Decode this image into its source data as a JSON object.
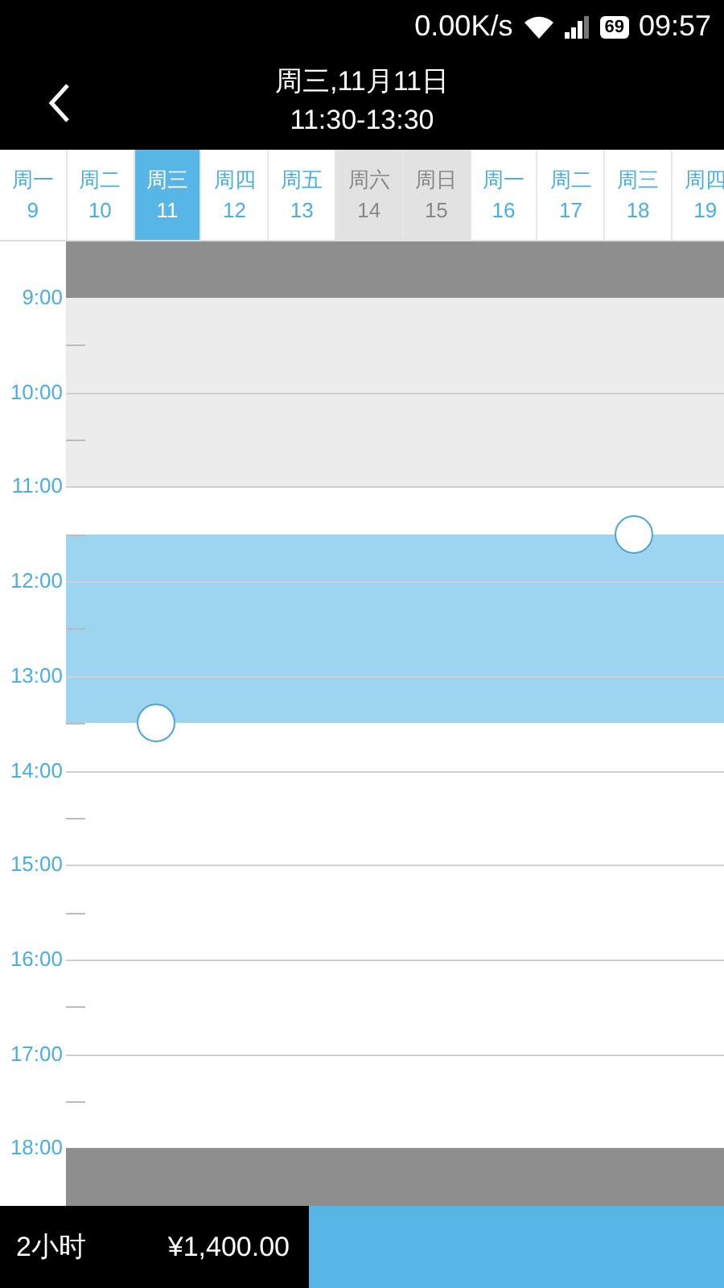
{
  "status_bar": {
    "network_speed": "0.00K/s",
    "battery": "69",
    "time": "09:57"
  },
  "header": {
    "title": "周三,11月11日",
    "subtitle": "11:30-13:30"
  },
  "days": [
    {
      "weekday": "周一",
      "day": "9",
      "selected": false,
      "weekend": false
    },
    {
      "weekday": "周二",
      "day": "10",
      "selected": false,
      "weekend": false
    },
    {
      "weekday": "周三",
      "day": "11",
      "selected": true,
      "weekend": false
    },
    {
      "weekday": "周四",
      "day": "12",
      "selected": false,
      "weekend": false
    },
    {
      "weekday": "周五",
      "day": "13",
      "selected": false,
      "weekend": false
    },
    {
      "weekday": "周六",
      "day": "14",
      "selected": false,
      "weekend": true
    },
    {
      "weekday": "周日",
      "day": "15",
      "selected": false,
      "weekend": true
    },
    {
      "weekday": "周一",
      "day": "16",
      "selected": false,
      "weekend": false
    },
    {
      "weekday": "周二",
      "day": "17",
      "selected": false,
      "weekend": false
    },
    {
      "weekday": "周三",
      "day": "18",
      "selected": false,
      "weekend": false
    },
    {
      "weekday": "周四",
      "day": "19",
      "selected": false,
      "weekend": false
    }
  ],
  "timeline": {
    "hours": [
      "9:00",
      "10:00",
      "11:00",
      "12:00",
      "13:00",
      "14:00",
      "15:00",
      "16:00",
      "17:00",
      "18:00"
    ]
  },
  "footer": {
    "duration": "2小时",
    "price": "¥1,400.00"
  }
}
